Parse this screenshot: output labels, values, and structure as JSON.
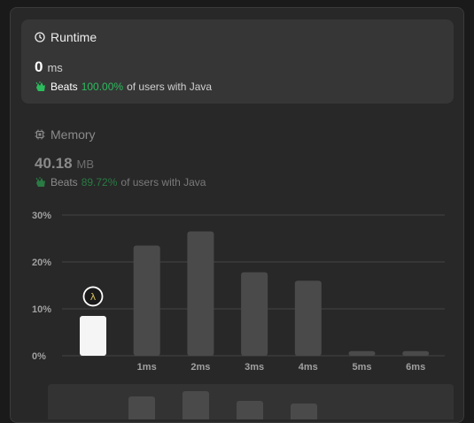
{
  "runtime": {
    "title": "Runtime",
    "value": "0",
    "unit": "ms",
    "beats_label": "Beats",
    "beats_pct": "100.00%",
    "beats_suffix": "of users with Java",
    "icon": "clock-icon"
  },
  "memory": {
    "title": "Memory",
    "value": "40.18",
    "unit": "MB",
    "beats_label": "Beats",
    "beats_pct": "89.72%",
    "beats_suffix": "of users with Java",
    "icon": "chip-icon"
  },
  "colors": {
    "accent_green": "#2cbb5d",
    "dim_green": "#2a7a44",
    "bar": "#4a4a4a",
    "highlight_bar": "#f5f5f5"
  },
  "chart_data": {
    "type": "bar",
    "categories": [
      "",
      "1ms",
      "2ms",
      "3ms",
      "4ms",
      "5ms",
      "6ms"
    ],
    "values": [
      8.5,
      23.5,
      26.5,
      17.8,
      16.0,
      1.0,
      1.0
    ],
    "highlight_index": 0,
    "marker_label": "λ",
    "yticks": [
      "30%",
      "20%",
      "10%",
      "0%"
    ],
    "ytick_values": [
      30,
      20,
      10,
      0
    ],
    "ylim": [
      0,
      30
    ],
    "grid": true
  },
  "mini_chart": {
    "values": [
      6.0,
      8.0,
      4.0,
      3.0
    ]
  }
}
